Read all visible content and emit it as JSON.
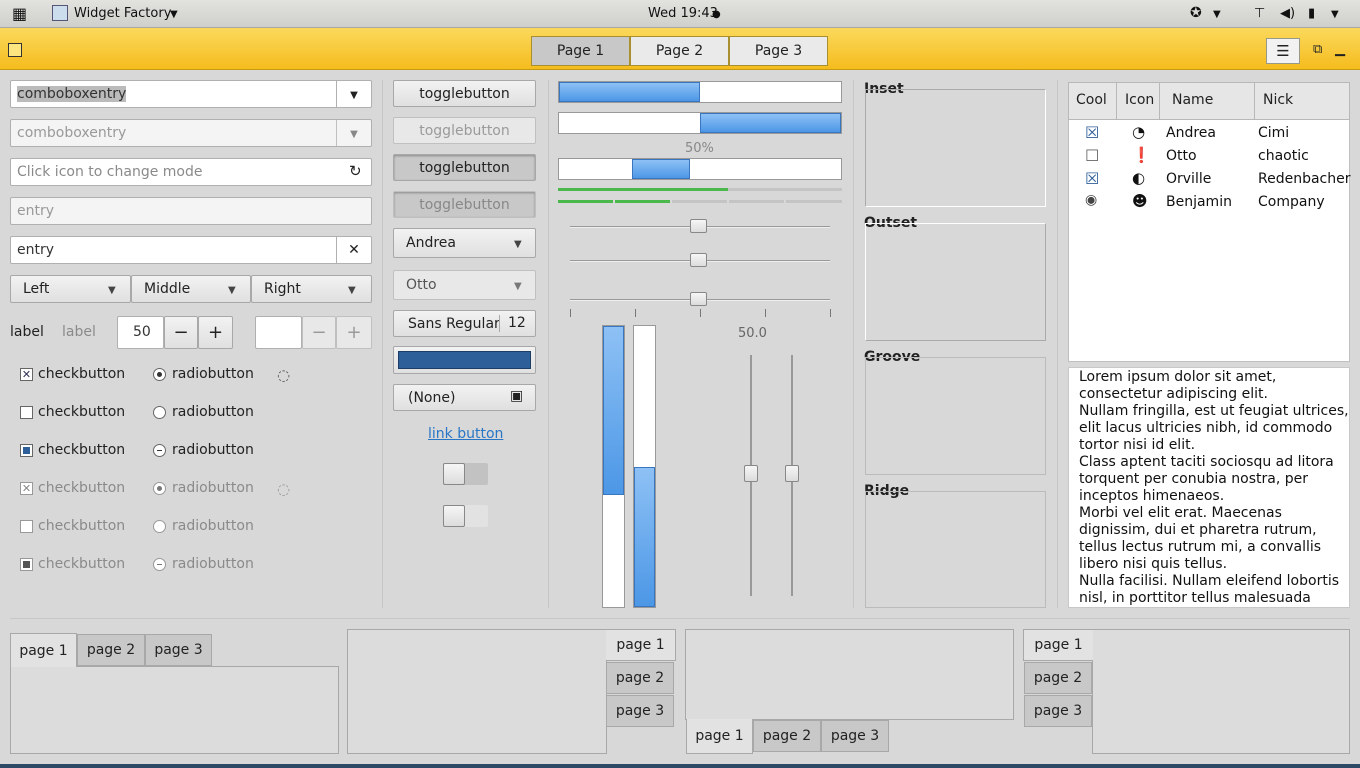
{
  "topbar": {
    "app_name": "Widget Factory",
    "clock": "Wed 19:43"
  },
  "header": {
    "stack": [
      "Page 1",
      "Page 2",
      "Page 3"
    ]
  },
  "col1": {
    "combo1": "comboboxentry",
    "combo2": "comboboxentry",
    "entry_placeholder": "Click icon to change mode",
    "entry_disabled": "entry",
    "entry_clear": "entry",
    "buttons": [
      "Left",
      "Middle",
      "Right"
    ],
    "label1": "label",
    "label2": "label",
    "spin_value": "50",
    "checks": [
      "checkbutton",
      "checkbutton",
      "checkbutton",
      "checkbutton",
      "checkbutton",
      "checkbutton"
    ],
    "radios": [
      "radiobutton",
      "radiobutton",
      "radiobutton",
      "radiobutton",
      "radiobutton",
      "radiobutton"
    ]
  },
  "col2": {
    "toggles": [
      "togglebutton",
      "togglebutton",
      "togglebutton",
      "togglebutton"
    ],
    "combo_andrea": "Andrea",
    "combo_otto": "Otto",
    "font_name": "Sans Regular",
    "font_size": "12",
    "file_none": "(None)",
    "link": "link button",
    "color_swatch": "#2f5f99"
  },
  "col3": {
    "progress1": 0.5,
    "progress2": 0.5,
    "progress3_label": "50%",
    "level_fraction": 0.6,
    "scale_value_label": "50.0",
    "vprogress1": 0.6,
    "vprogress2": 0.5
  },
  "frames": [
    "Inset",
    "Outset",
    "Groove",
    "Ridge"
  ],
  "tree": {
    "headers": [
      "Cool",
      "Icon",
      "Name",
      "Nick"
    ],
    "rows": [
      {
        "cool": "☒",
        "icon": "clock-icon",
        "name": "Andrea",
        "nick": "Cimi"
      },
      {
        "cool": "☐",
        "icon": "alert-icon",
        "name": "Otto",
        "nick": "chaotic"
      },
      {
        "cool": "☒",
        "icon": "moon-icon",
        "name": "Orville",
        "nick": "Redenbacher"
      },
      {
        "cool": "◉",
        "icon": "robot-icon",
        "name": "Benjamin",
        "nick": "Company"
      }
    ]
  },
  "textview": {
    "lines": [
      "Lorem ipsum dolor sit amet,",
      "consectetur adipiscing elit.",
      "Nullam fringilla, est ut feugiat ultrices,",
      "elit lacus ultricies nibh, id commodo",
      "tortor nisi id elit.",
      "Class aptent taciti sociosqu ad litora",
      "torquent per conubia nostra, per",
      "inceptos himenaeos.",
      "Morbi vel elit erat. Maecenas",
      "dignissim, dui et pharetra rutrum,",
      "tellus lectus rutrum mi, a convallis",
      "libero nisi quis tellus.",
      "Nulla facilisi. Nullam eleifend lobortis",
      "nisl, in porttitor tellus malesuada"
    ]
  },
  "notebooks": {
    "nb1": [
      "page 1",
      "page 2",
      "page 3"
    ],
    "nb2": [
      "page 1",
      "page 2",
      "page 3"
    ],
    "nb3": [
      "page 1",
      "page 2",
      "page 3"
    ],
    "nb4": [
      "page 1",
      "page 2",
      "page 3"
    ]
  }
}
